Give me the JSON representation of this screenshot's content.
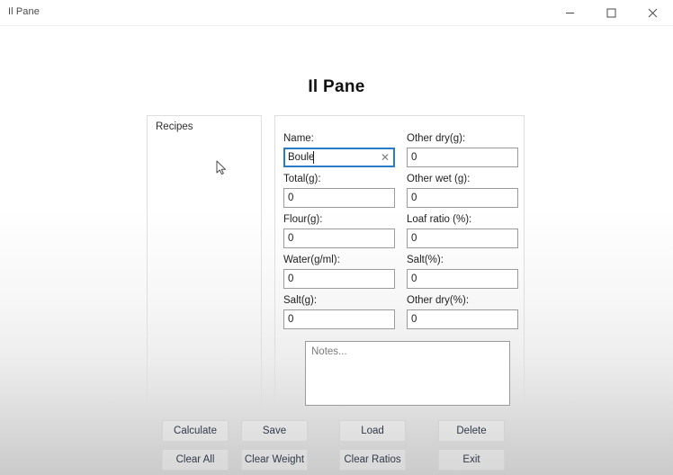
{
  "window": {
    "title": "Il Pane",
    "controls": {
      "minimize": "minimize",
      "maximize": "maximize",
      "close": "close"
    }
  },
  "heading": "Il Pane",
  "recipes": {
    "label": "Recipes",
    "items": []
  },
  "form": {
    "left_fields": [
      {
        "label": "Name:",
        "value": "Boule",
        "placeholder": "",
        "focused": true,
        "has_clear": true,
        "clear_glyph": "✕"
      },
      {
        "label": "Total(g):",
        "value": "0",
        "placeholder": "",
        "focused": false,
        "has_clear": false,
        "clear_glyph": ""
      },
      {
        "label": "Flour(g):",
        "value": "0",
        "placeholder": "",
        "focused": false,
        "has_clear": false,
        "clear_glyph": ""
      },
      {
        "label": "Water(g/ml):",
        "value": "0",
        "placeholder": "",
        "focused": false,
        "has_clear": false,
        "clear_glyph": ""
      },
      {
        "label": "Salt(g):",
        "value": "0",
        "placeholder": "",
        "focused": false,
        "has_clear": false,
        "clear_glyph": ""
      }
    ],
    "right_fields": [
      {
        "label": "Other dry(g):",
        "value": "0",
        "placeholder": ""
      },
      {
        "label": "Other wet (g):",
        "value": "0",
        "placeholder": ""
      },
      {
        "label": "Loaf ratio (%):",
        "value": "0",
        "placeholder": ""
      },
      {
        "label": "Salt(%):",
        "value": "0",
        "placeholder": ""
      },
      {
        "label": "Other dry(%):",
        "value": "0",
        "placeholder": ""
      }
    ],
    "notes": {
      "value": "",
      "placeholder": "Notes..."
    }
  },
  "buttons": {
    "row1": [
      {
        "label": "Calculate"
      },
      {
        "label": "Save"
      },
      {
        "label": "Load"
      },
      {
        "label": "Delete"
      }
    ],
    "row2": [
      {
        "label": "Clear All"
      },
      {
        "label": "Clear Weight"
      },
      {
        "label": "Clear Ratios"
      },
      {
        "label": "Exit"
      }
    ]
  },
  "colors": {
    "focus_border": "#2a7cc7",
    "input_border": "#9b9b9b",
    "panel_border": "#dedede",
    "button_text": "#2f3a4a",
    "title_text": "#4a4a4a"
  }
}
